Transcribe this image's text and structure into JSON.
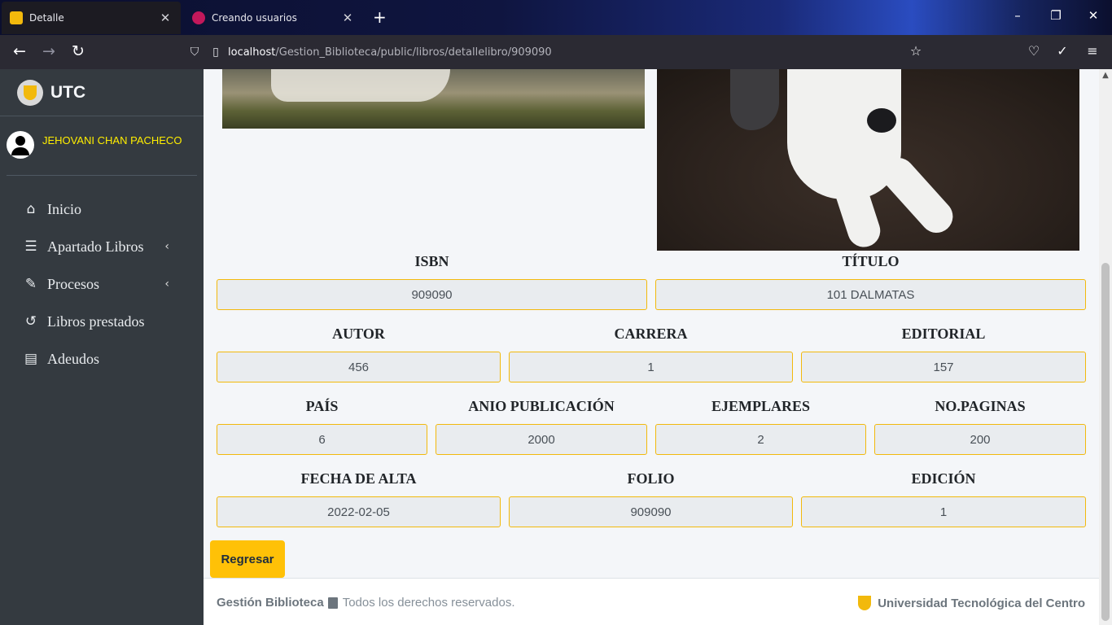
{
  "browser": {
    "tabs": [
      {
        "title": "Detalle",
        "close": "✕"
      },
      {
        "title": "Creando usuarios",
        "close": "✕"
      }
    ],
    "new_tab": "+",
    "url_host": "localhost",
    "url_path": "/Gestion_Biblioteca/public/libros/detallelibro/909090"
  },
  "sidebar": {
    "brand": "UTC",
    "user": "JEHOVANI CHAN PACHECO",
    "items": [
      {
        "label": "Inicio",
        "icon": "home-icon"
      },
      {
        "label": "Apartado Libros",
        "icon": "list-icon",
        "has_submenu": true
      },
      {
        "label": "Procesos",
        "icon": "edit-document-icon",
        "has_submenu": true
      },
      {
        "label": "Libros prestados",
        "icon": "history-icon"
      },
      {
        "label": "Adeudos",
        "icon": "invoice-icon"
      }
    ]
  },
  "book": {
    "isbn_label": "ISBN",
    "isbn": "909090",
    "titulo_label": "TÍTULO",
    "titulo": "101 DALMATAS",
    "autor_label": "AUTOR",
    "autor": "456",
    "carrera_label": "CARRERA",
    "carrera": "1",
    "editorial_label": "EDITORIAL",
    "editorial": "157",
    "pais_label": "PAÍS",
    "pais": "6",
    "anio_label": "ANIO PUBLICACIÓN",
    "anio": "2000",
    "ejemplares_label": "EJEMPLARES",
    "ejemplares": "2",
    "paginas_label": "NO.PAGINAS",
    "paginas": "200",
    "fecha_label": "FECHA DE ALTA",
    "fecha": "2022-02-05",
    "folio_label": "FOLIO",
    "folio": "909090",
    "edicion_label": "EDICIÓN",
    "edicion": "1"
  },
  "actions": {
    "back": "Regresar"
  },
  "footer": {
    "app": "Gestión Biblioteca",
    "rights": "Todos los derechos reservados.",
    "university": "Universidad Tecnológica del Centro"
  },
  "colors": {
    "accent": "#ffc107",
    "field_border": "#f2b90c",
    "sidebar": "#343a40",
    "username": "#ffee00"
  }
}
